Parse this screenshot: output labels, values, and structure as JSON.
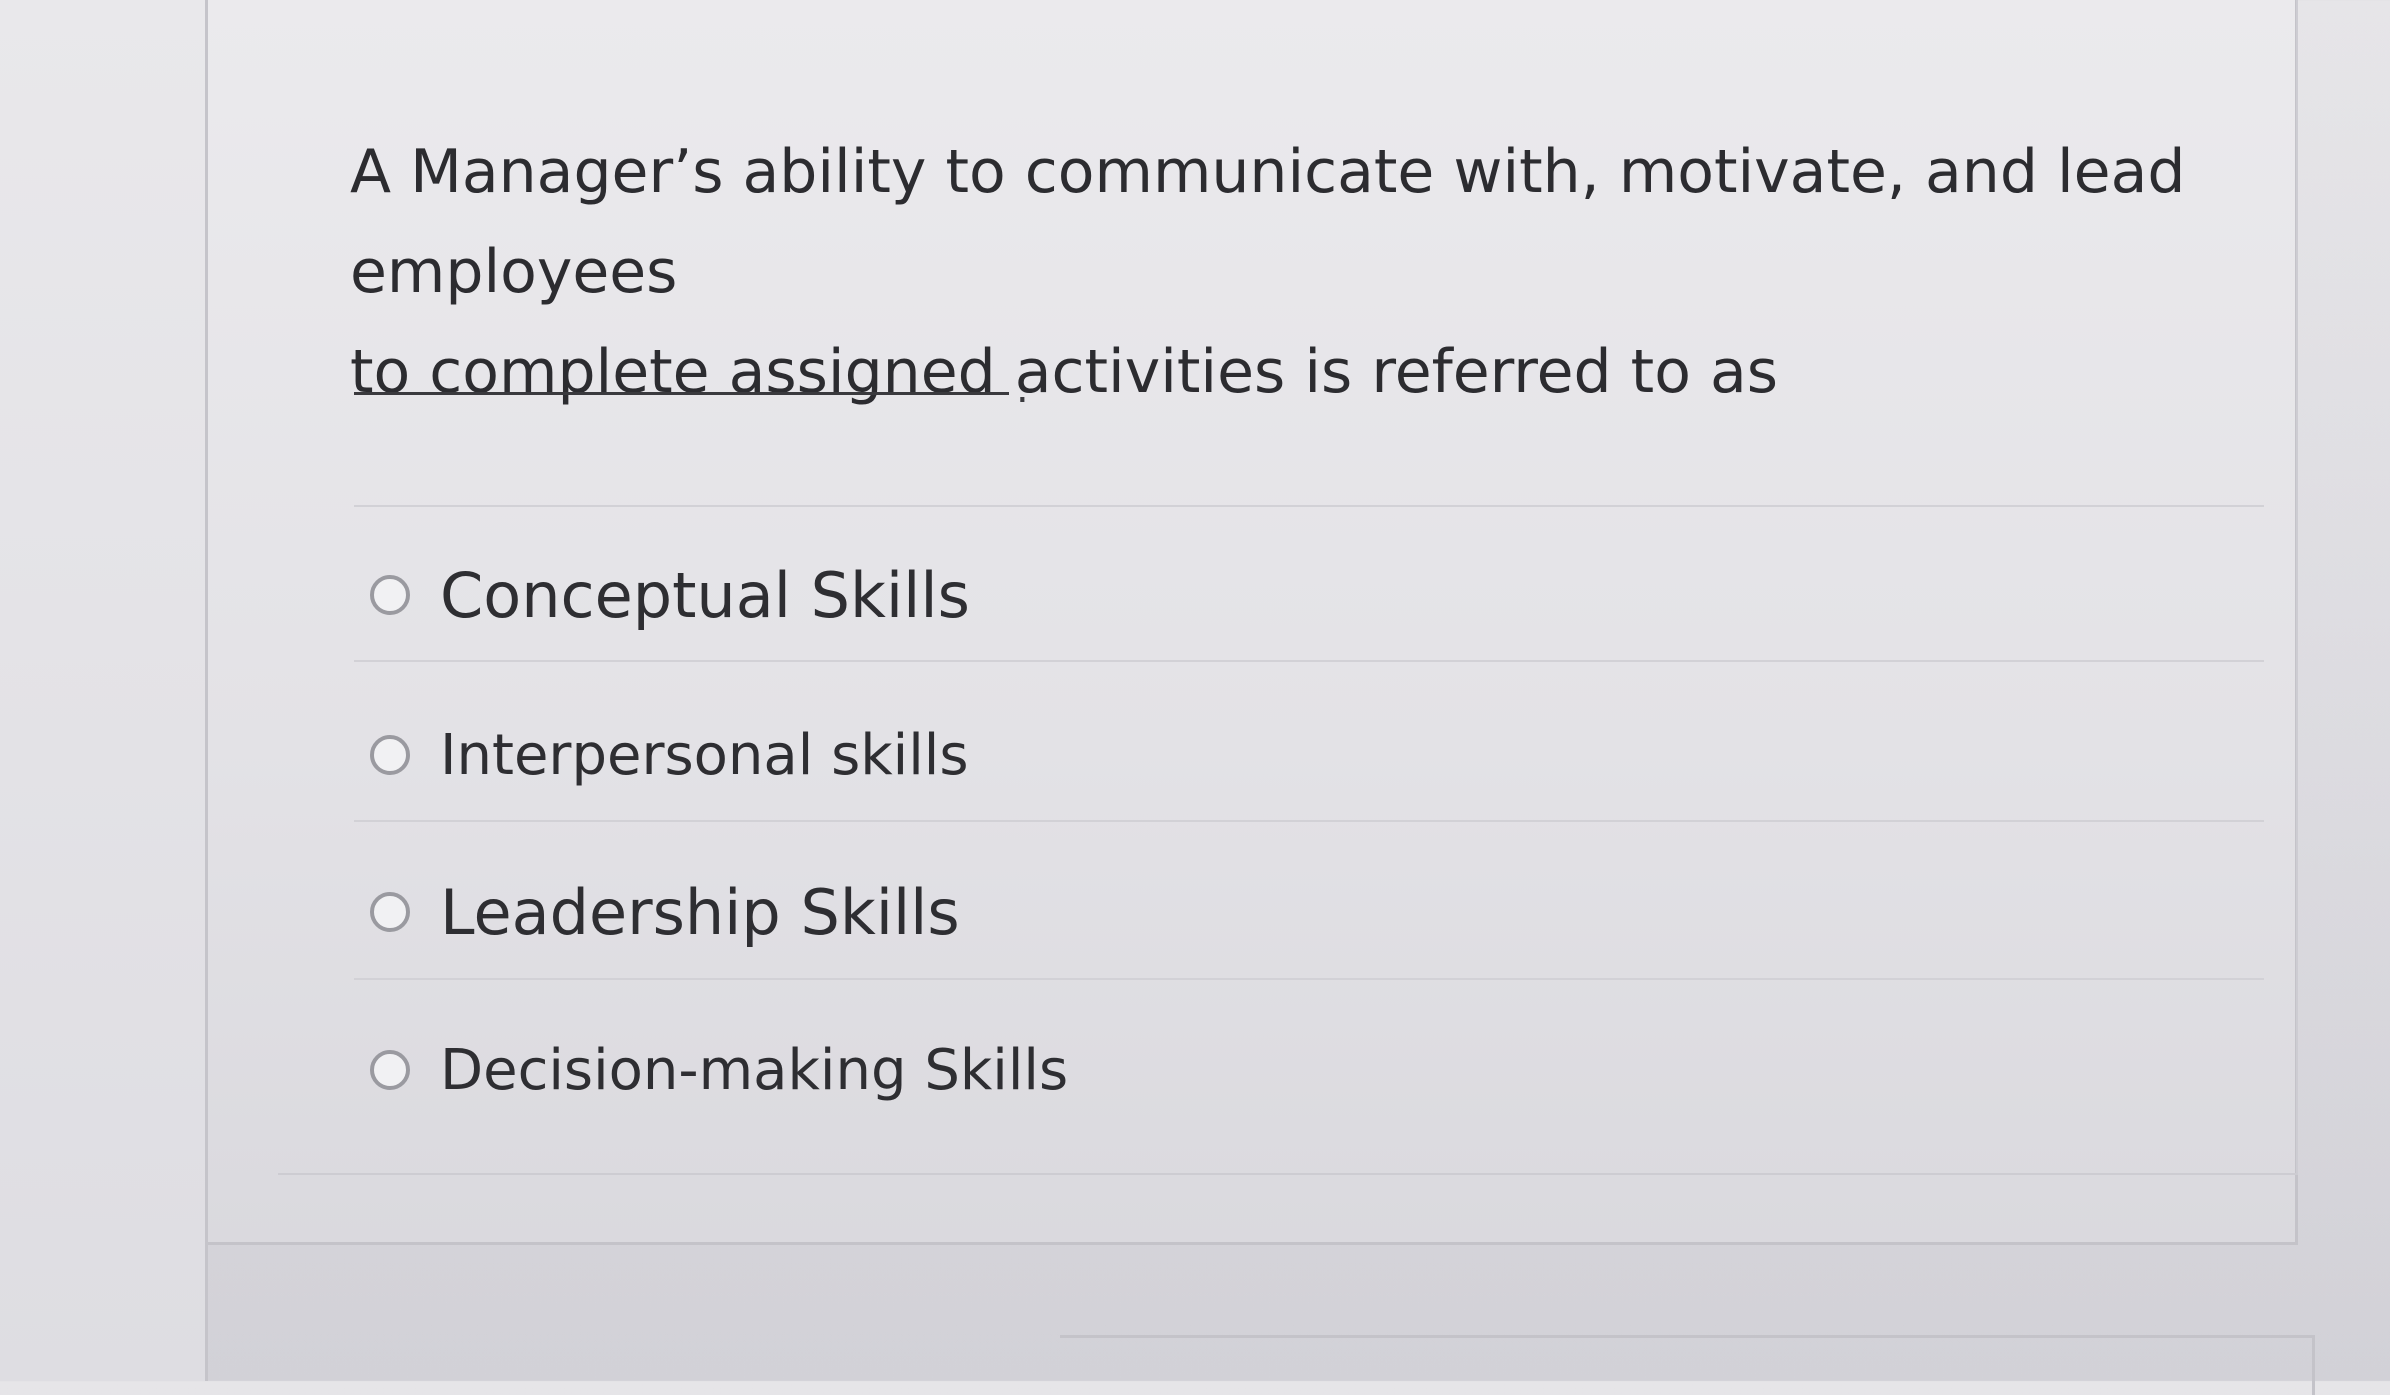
{
  "question": {
    "line1": "A Manager’s ability to communicate with, motivate, and lead employees",
    "line2": "to complete assigned activities is referred to as",
    "blank_punctuation": "."
  },
  "options": [
    {
      "label": "Conceptual Skills",
      "selected": false
    },
    {
      "label": "Interpersonal skills",
      "selected": false
    },
    {
      "label": "Leadership Skills",
      "selected": false
    },
    {
      "label": "Decision-making Skills",
      "selected": false
    }
  ],
  "colors": {
    "text": "#2c2c30",
    "radio_border": "#9a9aa0",
    "background": "#e6e5e8"
  }
}
